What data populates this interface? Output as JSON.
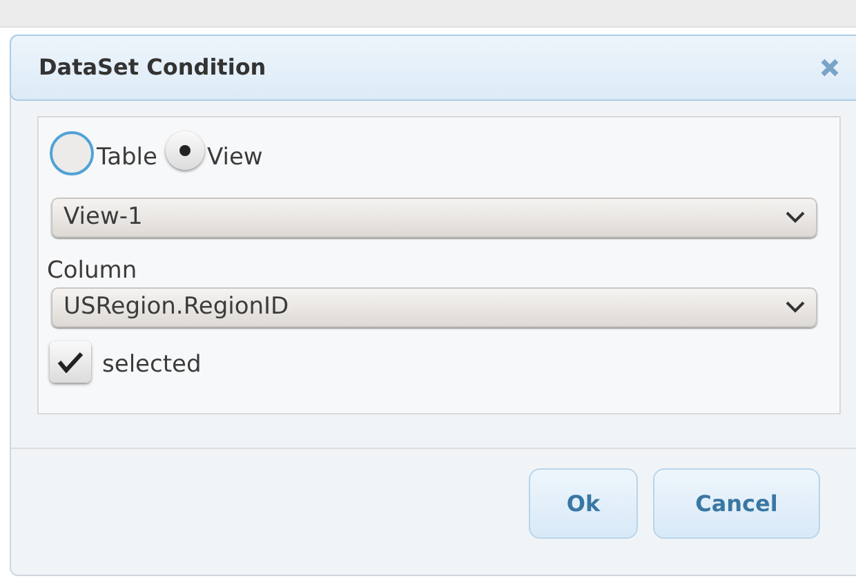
{
  "dialog": {
    "title": "DataSet Condition"
  },
  "source_options": [
    {
      "label": "Table",
      "selected": false
    },
    {
      "label": "View",
      "selected": true
    }
  ],
  "source_select": {
    "value": "View-1"
  },
  "column": {
    "label": "Column",
    "value": "USRegion.RegionID"
  },
  "selected_checkbox": {
    "label": "selected",
    "checked": true
  },
  "buttons": [
    {
      "label": "Ok"
    },
    {
      "label": "Cancel"
    }
  ]
}
